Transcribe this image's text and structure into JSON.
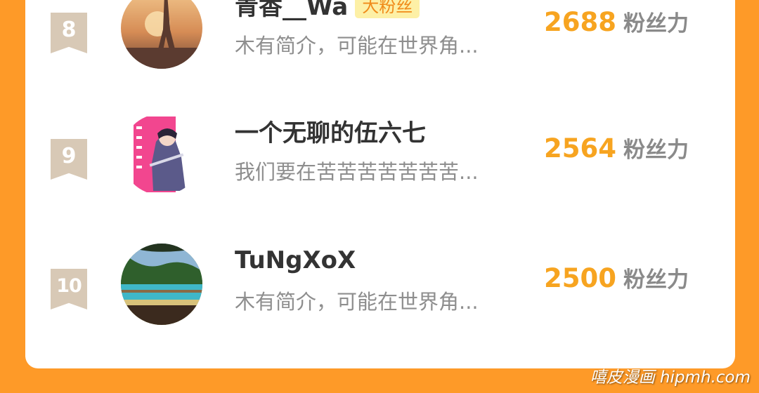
{
  "ranking": [
    {
      "rank": "8",
      "name": "青香__Wa",
      "badge": "大粉丝",
      "intro": "木有简介，可能在世界角...",
      "score": "2688",
      "score_unit": "粉丝力"
    },
    {
      "rank": "9",
      "name": "一个无聊的伍六七",
      "badge": "",
      "intro": "我们要在苦苦苦苦苦苦苦...",
      "score": "2564",
      "score_unit": "粉丝力"
    },
    {
      "rank": "10",
      "name": "TuNgXoX",
      "badge": "",
      "intro": "木有简介，可能在世界角...",
      "score": "2500",
      "score_unit": "粉丝力"
    }
  ],
  "watermark": "嘻皮漫画 hipmh.com",
  "colors": {
    "background": "#fe9a28",
    "score": "#f7a420",
    "badge_bg": "#fdf0a6",
    "rank_ribbon": "#d8c9b6"
  }
}
